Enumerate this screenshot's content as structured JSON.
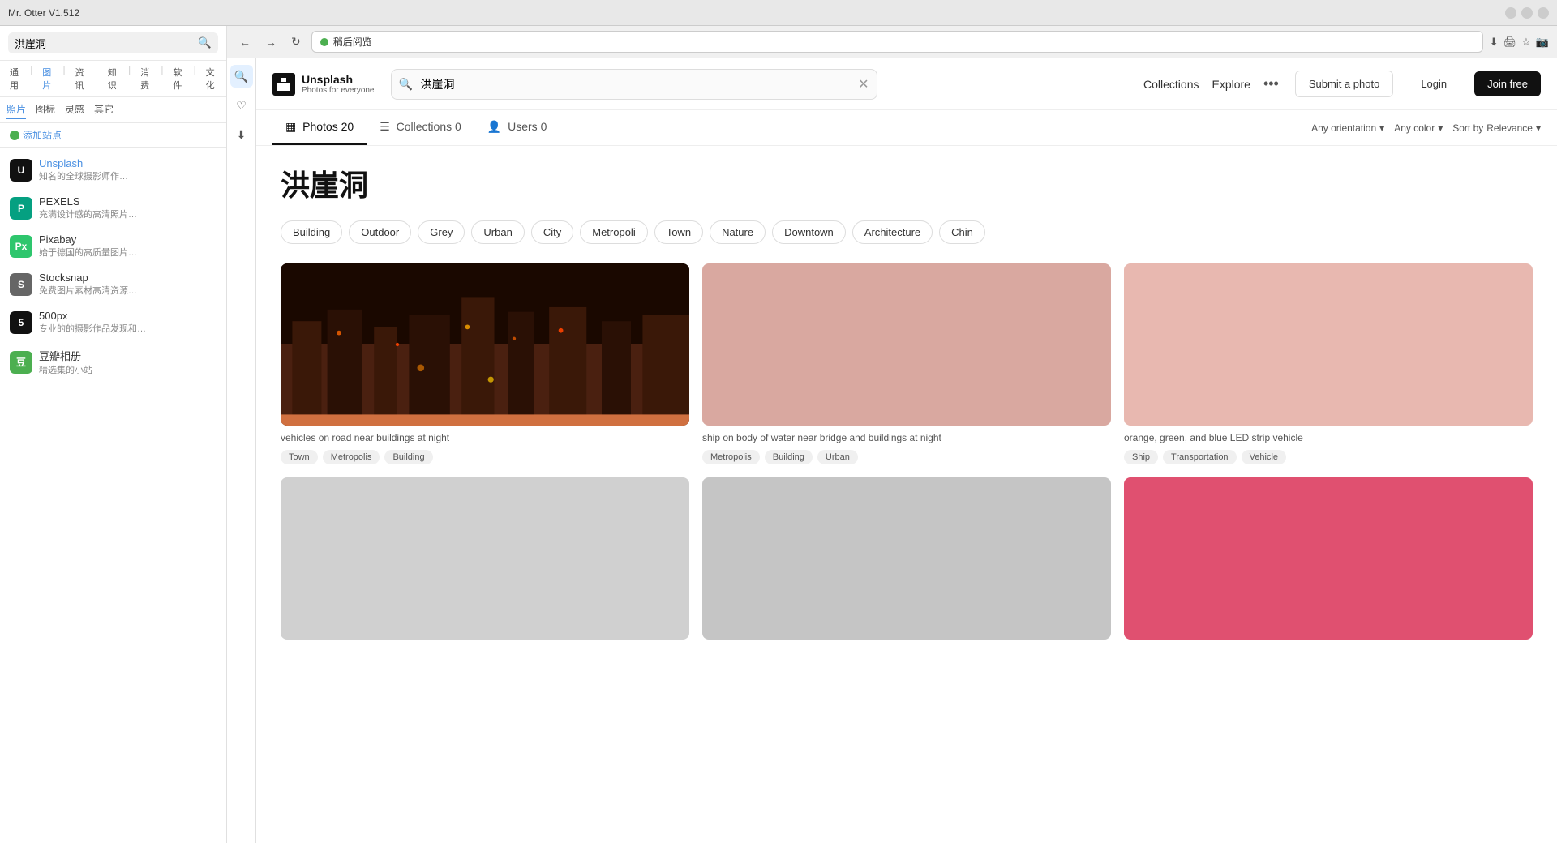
{
  "window": {
    "title": "Mr. Otter V1.512",
    "controls": [
      "minimize",
      "maximize",
      "close"
    ]
  },
  "left_sidebar": {
    "search_placeholder": "洪崖洞",
    "nav_top": [
      "通用",
      "图片",
      "资讯",
      "知识",
      "消费",
      "软件",
      "文化"
    ],
    "sub_tabs": [
      "照片",
      "图标",
      "灵感",
      "其它"
    ],
    "add_site_label": "添加站点",
    "sites": [
      {
        "id": "unsplash",
        "name": "Unsplash",
        "desc": "知名的全球摄影师作…",
        "icon_text": "U",
        "icon_bg": "#111",
        "icon_color": "#fff",
        "name_color": "#4A90E2"
      },
      {
        "id": "pexels",
        "name": "PEXELS",
        "desc": "充满设计感的高清照片…",
        "icon_text": "P",
        "icon_bg": "#05a081",
        "icon_color": "#fff",
        "name_color": "#333"
      },
      {
        "id": "pixabay",
        "name": "Pixabay",
        "desc": "始于德国的高质量图片…",
        "icon_text": "Px",
        "icon_bg": "#2ec66d",
        "icon_color": "#fff",
        "name_color": "#333"
      },
      {
        "id": "stocksnap",
        "name": "Stocksnap",
        "desc": "免费图片素材高清资源…",
        "icon_text": "S",
        "icon_bg": "#666",
        "icon_color": "#fff",
        "name_color": "#333"
      },
      {
        "id": "500px",
        "name": "500px",
        "desc": "专业的的摄影作品发现和…",
        "icon_text": "5",
        "icon_bg": "#111",
        "icon_color": "#fff",
        "name_color": "#333"
      },
      {
        "id": "douban",
        "name": "豆瓣相册",
        "desc": "精选集的小站",
        "icon_text": "豆",
        "icon_bg": "#4caf50",
        "icon_color": "#fff",
        "name_color": "#333"
      }
    ]
  },
  "browser_toolbar": {
    "address": "稍后阅览"
  },
  "unsplash": {
    "logo_name": "Unsplash",
    "logo_tagline": "Photos for everyone",
    "search_value": "洪崖洞",
    "nav_links": [
      "Collections",
      "Explore"
    ],
    "submit_photo": "Submit a photo",
    "login": "Login",
    "join_free": "Join free",
    "filter_tabs": [
      {
        "label": "Photos 20",
        "active": true
      },
      {
        "label": "Collections 0",
        "active": false
      },
      {
        "label": "Users 0",
        "active": false
      }
    ],
    "sort_options": {
      "orientation": "Any orientation",
      "color": "Any color",
      "sort": "Relevance"
    },
    "search_title": "洪崖洞",
    "tags": [
      "Building",
      "Outdoor",
      "Grey",
      "Urban",
      "City",
      "Metropoli",
      "Town",
      "Nature",
      "Downtown",
      "Architecture",
      "Chin"
    ],
    "photos": [
      {
        "id": "photo-1",
        "caption": "vehicles on road near buildings at night",
        "tags": [
          "Town",
          "Metropolis",
          "Building"
        ],
        "type": "night-city"
      },
      {
        "id": "photo-2",
        "caption": "ship on body of water near bridge and buildings at night",
        "tags": [
          "Metropolis",
          "Building",
          "Urban"
        ],
        "type": "pink-light"
      },
      {
        "id": "photo-3",
        "caption": "orange, green, and blue LED strip vehicle",
        "tags": [
          "Ship",
          "Transportation",
          "Vehicle"
        ],
        "type": "pink-medium"
      },
      {
        "id": "photo-4",
        "caption": "",
        "tags": [],
        "type": "grey-light"
      },
      {
        "id": "photo-5",
        "caption": "",
        "tags": [],
        "type": "grey-medium"
      },
      {
        "id": "photo-6",
        "caption": "",
        "tags": [],
        "type": "pink-hot"
      }
    ]
  }
}
